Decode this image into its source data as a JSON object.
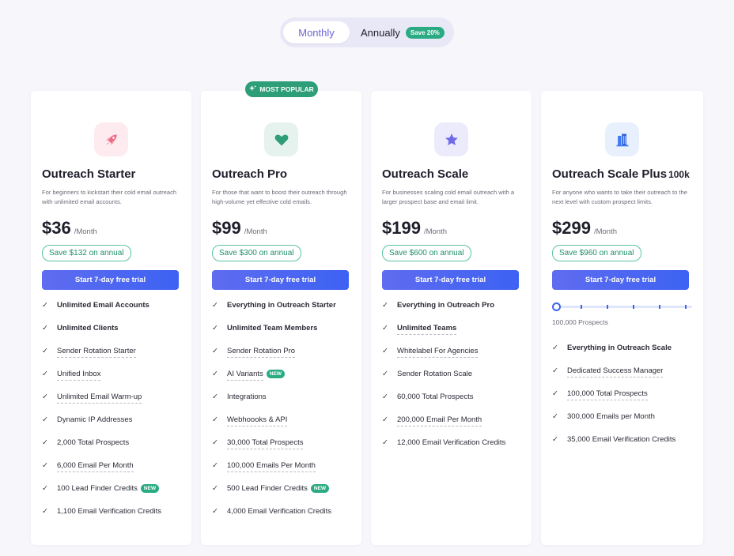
{
  "toggle": {
    "monthly": "Monthly",
    "annually": "Annually",
    "save_badge": "Save 20%"
  },
  "popular_badge": "MOST POPULAR",
  "colors": {
    "accent": "#3d62f3",
    "green": "#2bab83",
    "background": "#f7f6fb"
  },
  "plans": [
    {
      "icon": "rocket-icon",
      "name": "Outreach Starter",
      "description": "For beginners to kickstart their cold email outreach with unlimited email accounts.",
      "price": "$36",
      "period": "/Month",
      "save": "Save $132 on annual",
      "cta": "Start 7-day free trial",
      "features": [
        "Unlimited Email Accounts",
        "Unlimited Clients",
        "Sender Rotation Starter",
        "Unified Inbox",
        "Unlimited Email Warm-up",
        "Dynamic IP Addresses",
        "2,000 Total Prospects",
        "6,000 Email Per Month",
        "100 Lead Finder Credits",
        "1,100 Email Verification Credits"
      ]
    },
    {
      "icon": "heart-icon",
      "name": "Outreach Pro",
      "description": "For those that want to boost their outreach through high-volume yet effective cold emails.",
      "price": "$99",
      "period": "/Month",
      "save": "Save $300 on annual",
      "cta": "Start 7-day free trial",
      "features": [
        "Everything in Outreach Starter",
        "Unlimited Team Members",
        "Sender Rotation Pro",
        "AI Variants",
        "Integrations",
        "Webhoooks & API",
        "30,000 Total Prospects",
        "100,000 Emails Per Month",
        "500 Lead Finder Credits",
        "4,000 Email Verification Credits"
      ]
    },
    {
      "icon": "star-icon",
      "name": "Outreach Scale",
      "description": "For businesses scaling cold email outreach with a larger prospect base and email limit.",
      "price": "$199",
      "period": "/Month",
      "save": "Save $600 on annual",
      "cta": "Start 7-day free trial",
      "features": [
        "Everything in Outreach Pro",
        "Unlimited Teams",
        "Whitelabel For Agencies",
        "Sender Rotation Scale",
        "60,000 Total Prospects",
        "200,000 Email Per Month",
        "12,000 Email Verification Credits"
      ]
    },
    {
      "icon": "building-icon",
      "name": "Outreach Scale Plus",
      "name_suffix": "100k",
      "description": "For anyone who wants to take their outreach to the next level with custom prospect limits.",
      "price": "$299",
      "period": "/Month",
      "save": "Save $960 on annual",
      "cta": "Start 7-day free trial",
      "slider_label": "100,000 Prospects",
      "slider_value": 0,
      "features": [
        "Everything in Outreach Scale",
        "Dedicated Success Manager",
        "100,000 Total Prospects",
        "300,000 Emails per Month",
        "35,000 Email Verification Credits"
      ]
    }
  ],
  "new_badge": "NEW"
}
